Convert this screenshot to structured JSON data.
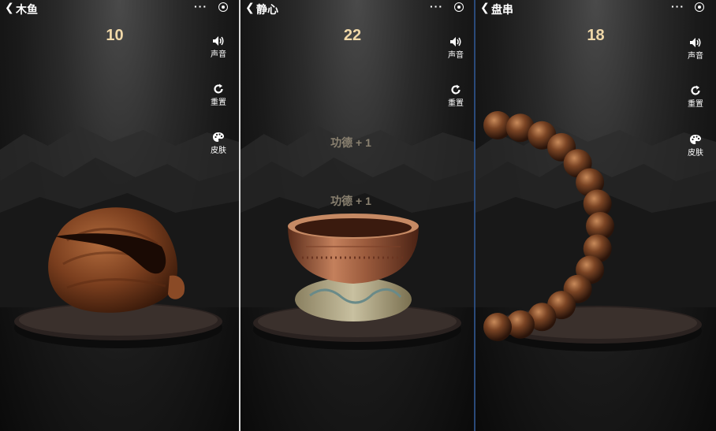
{
  "panels": [
    {
      "title": "木鱼",
      "count": "10",
      "sound_label": "声音",
      "reset_label": "重置",
      "skin_label": "皮肤"
    },
    {
      "title": "静心",
      "count": "22",
      "sound_label": "声音",
      "reset_label": "重置",
      "skin_label": "皮肤",
      "merit": [
        "功德 + 1",
        "功德 + 1"
      ]
    },
    {
      "title": "盘串",
      "count": "18",
      "sound_label": "声音",
      "reset_label": "重置",
      "skin_label": "皮肤"
    }
  ],
  "more_label": "···",
  "colors": {
    "count": "#f0d8a8",
    "merit": "#8a8170",
    "wood": "#8a4a26",
    "copper": "#b06a48"
  },
  "icons": [
    "back-icon",
    "more-icon",
    "record-icon",
    "speaker-icon",
    "reset-icon",
    "palette-icon"
  ]
}
